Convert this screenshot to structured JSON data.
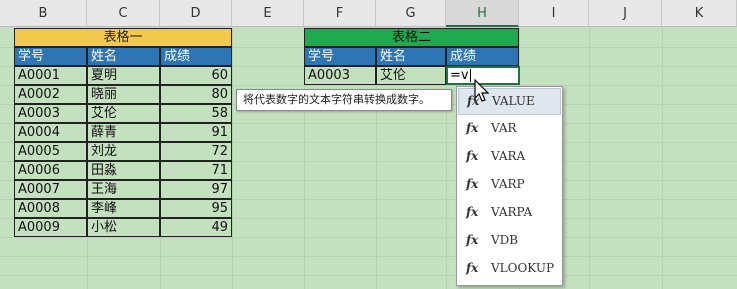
{
  "columns": [
    "B",
    "C",
    "D",
    "E",
    "F",
    "G",
    "H",
    "I",
    "J",
    "K"
  ],
  "selected_column": "H",
  "table1": {
    "title": "表格一",
    "headers": [
      "学号",
      "姓名",
      "成绩"
    ],
    "rows": [
      [
        "A0001",
        "夏明",
        "60"
      ],
      [
        "A0002",
        "晓丽",
        "80"
      ],
      [
        "A0003",
        "艾伦",
        "58"
      ],
      [
        "A0004",
        "薛青",
        "91"
      ],
      [
        "A0005",
        "刘龙",
        "72"
      ],
      [
        "A0006",
        "田淼",
        "71"
      ],
      [
        "A0007",
        "王海",
        "97"
      ],
      [
        "A0008",
        "李峰",
        "95"
      ],
      [
        "A0009",
        "小松",
        "49"
      ]
    ]
  },
  "table2": {
    "title": "表格二",
    "headers": [
      "学号",
      "姓名",
      "成绩"
    ],
    "row": [
      "A0003",
      "艾伦"
    ],
    "formula_input": "=v"
  },
  "tooltip": "将代表数字的文本字符串转换成数字。",
  "autocomplete": {
    "fx_label": "fx",
    "items": [
      "VALUE",
      "VAR",
      "VARA",
      "VARP",
      "VARPA",
      "VDB",
      "VLOOKUP"
    ],
    "selected": "VALUE"
  },
  "colors": {
    "sheet_bg": "#c4e1bf",
    "title1_bg": "#f2c94c",
    "title2_bg": "#1faa4f",
    "header_bg": "#2e75b6",
    "selection": "#217346"
  }
}
